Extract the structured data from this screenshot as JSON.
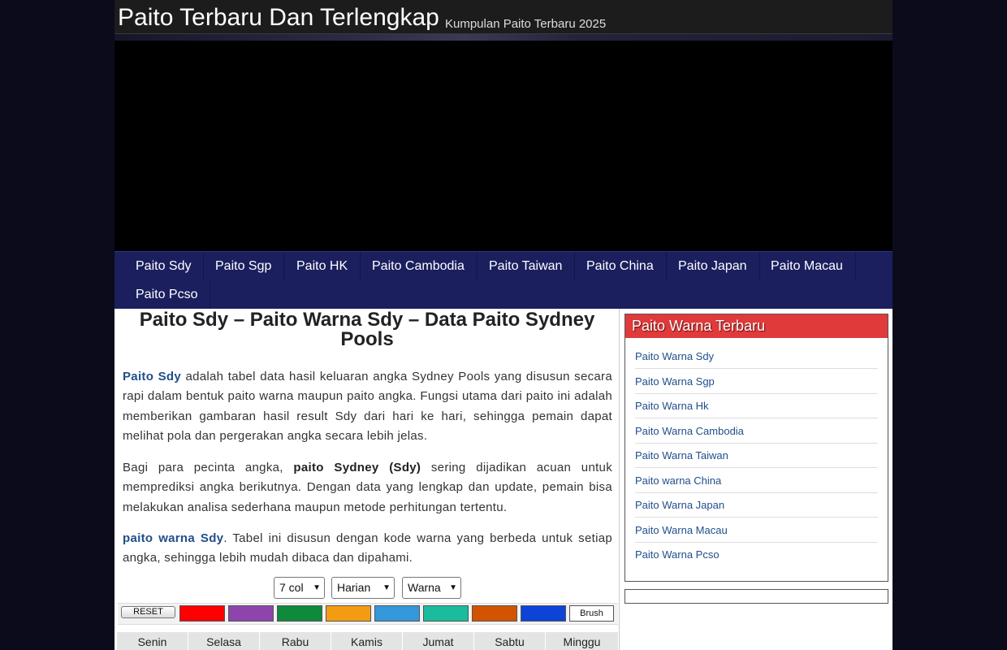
{
  "site": {
    "title": "Paito Terbaru Dan Terlengkap",
    "description": "Kumpulan Paito Terbaru 2025"
  },
  "nav": {
    "items": [
      {
        "label": "Paito Sdy"
      },
      {
        "label": "Paito Sgp"
      },
      {
        "label": "Paito HK"
      },
      {
        "label": "Paito Cambodia"
      },
      {
        "label": "Paito Taiwan"
      },
      {
        "label": "Paito China"
      },
      {
        "label": "Paito Japan"
      },
      {
        "label": "Paito Macau"
      },
      {
        "label": "Paito Pcso"
      }
    ]
  },
  "article": {
    "title": "Paito Sdy – Paito Warna Sdy – Data Paito Sydney Pools",
    "p1": {
      "link": "Paito Sdy",
      "text": " adalah tabel data hasil keluaran angka Sydney Pools yang disusun secara rapi dalam bentuk paito warna maupun paito angka. Fungsi utama dari paito ini adalah memberikan gambaran hasil result Sdy dari hari ke hari, sehingga pemain dapat melihat pola dan pergerakan angka secara lebih jelas."
    },
    "p2": {
      "pre": "Bagi para pecinta angka, ",
      "bold": "paito Sydney (Sdy)",
      "post": " sering dijadikan acuan untuk memprediksi angka berikutnya. Dengan data yang lengkap dan update, pemain bisa melakukan analisa sederhana maupun metode perhitungan tertentu."
    },
    "p3": {
      "link": "paito warna Sdy",
      "text": ". Tabel ini disusun dengan kode warna yang berbeda untuk setiap angka, sehingga lebih mudah dibaca dan dipahami."
    }
  },
  "controls": {
    "columns": "7 col",
    "period": "Harian",
    "mode": "Warna",
    "reset_label": "RESET",
    "brush_label": "Brush",
    "swatches": [
      {
        "name": "red",
        "color": "#ff0000"
      },
      {
        "name": "purple",
        "color": "#8e44ad"
      },
      {
        "name": "green",
        "color": "#0e8a3a"
      },
      {
        "name": "orange",
        "color": "#f39c12"
      },
      {
        "name": "light-blue",
        "color": "#3498db"
      },
      {
        "name": "teal",
        "color": "#1abc9c"
      },
      {
        "name": "dark-orange",
        "color": "#d35400"
      },
      {
        "name": "blue",
        "color": "#0b44d6"
      }
    ]
  },
  "table": {
    "days": [
      "Senin",
      "Selasa",
      "Rabu",
      "Kamis",
      "Jumat",
      "Sabtu",
      "Minggu"
    ]
  },
  "sidebar": {
    "heading": "Paito Warna Terbaru",
    "links": [
      {
        "label": "Paito Warna Sdy"
      },
      {
        "label": "Paito Warna Sgp"
      },
      {
        "label": "Paito Warna Hk"
      },
      {
        "label": "Paito Warna Cambodia"
      },
      {
        "label": "Paito Warna Taiwan"
      },
      {
        "label": "Paito warna China"
      },
      {
        "label": "Paito Warna Japan"
      },
      {
        "label": "Paito Warna Macau"
      },
      {
        "label": "Paito Warna Pcso"
      }
    ]
  }
}
